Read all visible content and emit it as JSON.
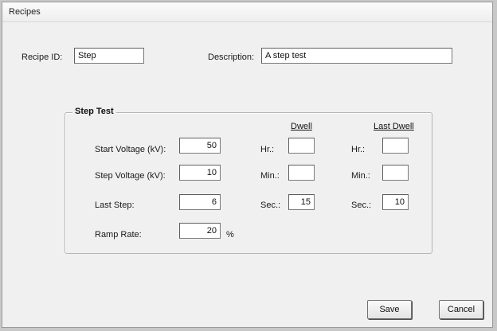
{
  "window": {
    "title": "Recipes"
  },
  "recipe_id": {
    "label": "Recipe ID:",
    "value": "Step"
  },
  "description": {
    "label": "Description:",
    "value": "A step test"
  },
  "step_test": {
    "title": "Step Test",
    "start_voltage": {
      "label": "Start Voltage (kV):",
      "value": "50"
    },
    "step_voltage": {
      "label": "Step Voltage (kV):",
      "value": "10"
    },
    "last_step": {
      "label": "Last Step:",
      "value": "6"
    },
    "ramp_rate": {
      "label": "Ramp Rate:",
      "value": "20",
      "unit": "%"
    },
    "dwell": {
      "heading": "Dwell",
      "hr": {
        "label": "Hr.:",
        "value": ""
      },
      "min": {
        "label": "Min.:",
        "value": ""
      },
      "sec": {
        "label": "Sec.:",
        "value": "15"
      }
    },
    "last_dwell": {
      "heading": "Last Dwell",
      "hr": {
        "label": "Hr.:",
        "value": ""
      },
      "min": {
        "label": "Min.:",
        "value": ""
      },
      "sec": {
        "label": "Sec.:",
        "value": "10"
      }
    }
  },
  "buttons": {
    "save": "Save",
    "cancel": "Cancel"
  }
}
